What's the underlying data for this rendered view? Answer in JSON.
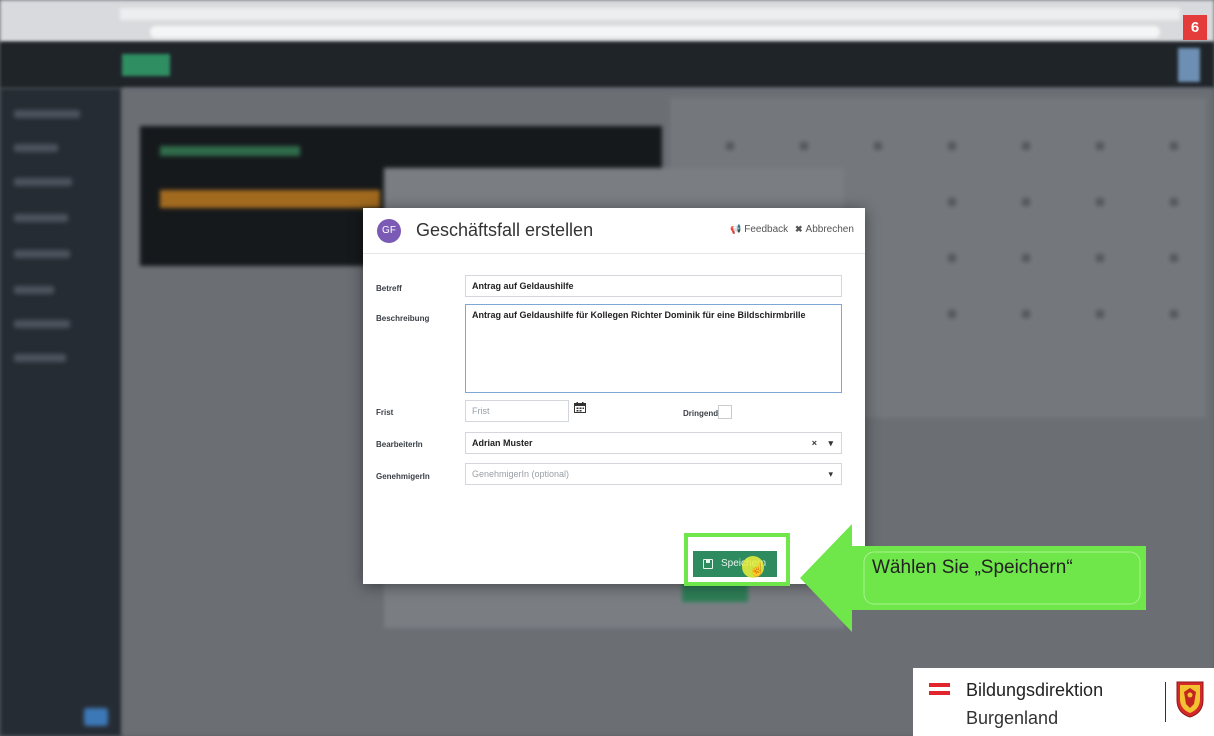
{
  "step_badge": "6",
  "modal": {
    "avatar_initials": "GF",
    "title": "Geschäftsfall erstellen",
    "feedback_label": "Feedback",
    "cancel_label": "Abbrechen",
    "fields": {
      "betreff": {
        "label": "Betreff",
        "value": "Antrag auf Geldaushilfe"
      },
      "beschreibung": {
        "label": "Beschreibung",
        "value": "Antrag auf Geldaushilfe für Kollegen Richter Dominik für eine Bildschirmbrille"
      },
      "frist": {
        "label": "Frist",
        "placeholder": "Frist"
      },
      "dringend": {
        "label": "Dringend",
        "checked": false
      },
      "bearbeiterin": {
        "label": "BearbeiterIn",
        "value": "Adrian Muster",
        "clear_glyph": "×",
        "caret_glyph": "▾"
      },
      "genehmigerin": {
        "label": "GenehmigerIn",
        "placeholder": "GenehmigerIn (optional)",
        "caret_glyph": "▾"
      }
    },
    "save_label": "Speichern"
  },
  "tutorial": {
    "instruction": "Wählen Sie „Speichern“",
    "highlight_color": "#6fe64a",
    "arrow_color": "#6fe64a"
  },
  "branding": {
    "name_line1": "Bildungsdirektion",
    "name_line2": "Burgenland"
  },
  "colors": {
    "save_button": "#2e8a5f",
    "avatar": "#7a5ab5",
    "badge": "#e43b3b"
  }
}
